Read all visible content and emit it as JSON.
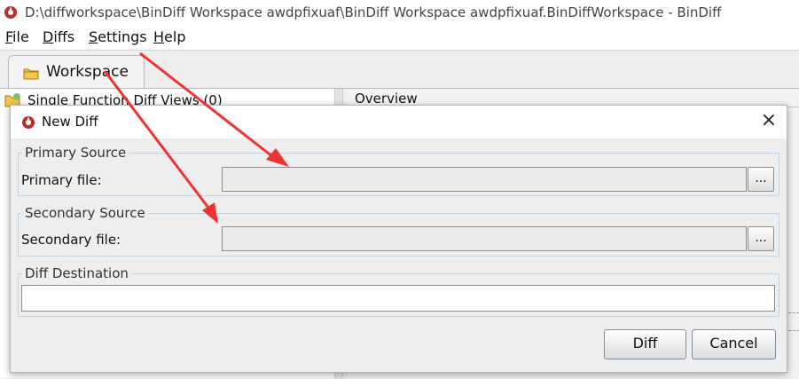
{
  "window": {
    "title": "D:\\diffworkspace\\BinDiff Workspace awdpfixuaf\\BinDiff Workspace awdpfixuaf.BinDiffWorkspace - BinDiff",
    "icon": "bindiff-logo-icon"
  },
  "menu": [
    {
      "mnemonic": "F",
      "rest": "ile"
    },
    {
      "mnemonic": "D",
      "rest": "iffs"
    },
    {
      "mnemonic": "S",
      "rest": "ettings"
    },
    {
      "mnemonic": "H",
      "rest": "elp"
    }
  ],
  "tab": {
    "label": "Workspace",
    "icon": "folder-icon"
  },
  "tree": {
    "item_label": "Single Function Diff Views (0)",
    "icon": "folder-icon"
  },
  "overview": {
    "label": "Overview"
  },
  "dialog": {
    "title": "New Diff",
    "close": "×",
    "primary": {
      "legend": "Primary Source",
      "label": "Primary file:",
      "value": "",
      "browse": "..."
    },
    "secondary": {
      "legend": "Secondary Source",
      "label": "Secondary file:",
      "value": "",
      "browse": "..."
    },
    "destination": {
      "legend": "Diff Destination",
      "value": ""
    },
    "buttons": {
      "diff": "Diff",
      "cancel": "Cancel"
    }
  },
  "colors": {
    "annotation_arrow": "#ee3333",
    "accent": "#7d8fa3"
  }
}
